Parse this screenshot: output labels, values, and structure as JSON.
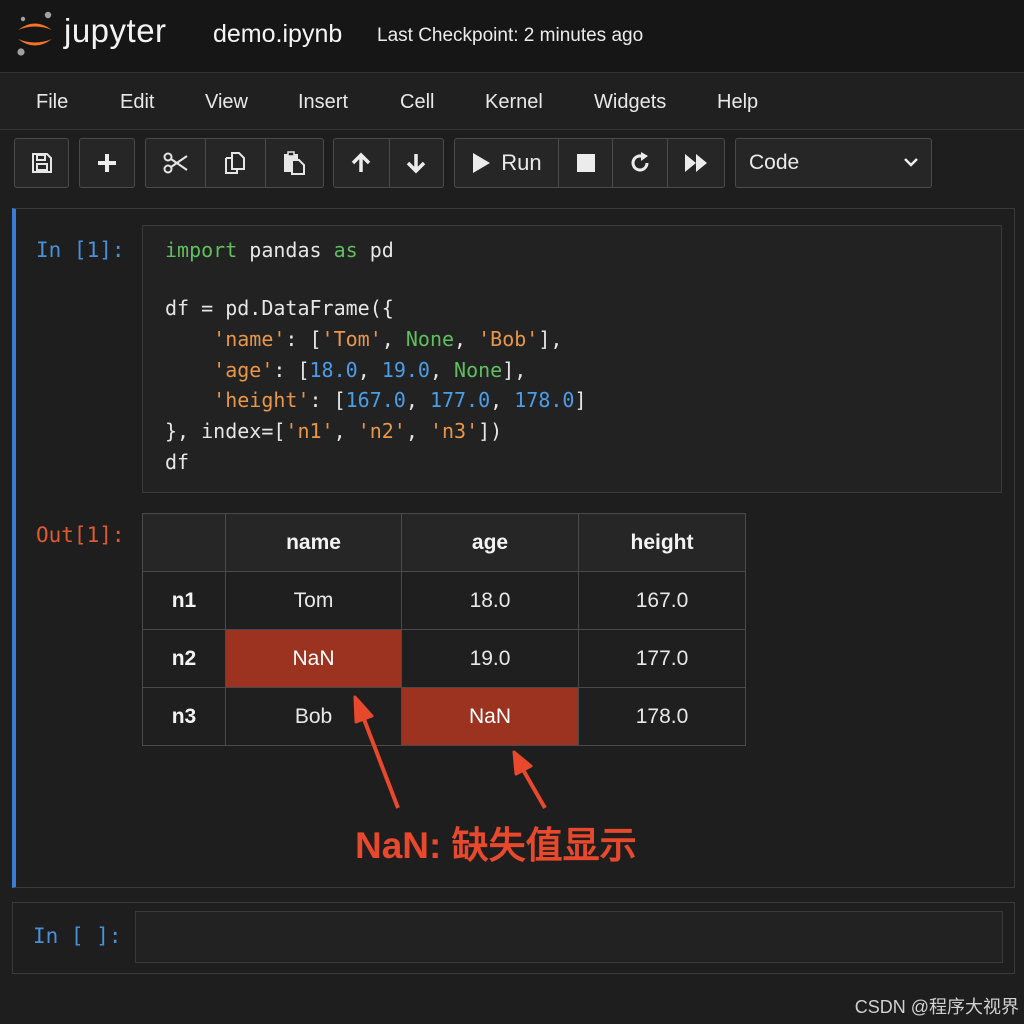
{
  "header": {
    "logo_text": "jupyter",
    "notebook_name": "demo.ipynb",
    "checkpoint": "Last Checkpoint: 2 minutes ago"
  },
  "menu": [
    "File",
    "Edit",
    "View",
    "Insert",
    "Cell",
    "Kernel",
    "Widgets",
    "Help"
  ],
  "toolbar": {
    "run_label": "Run",
    "cell_type": "Code"
  },
  "cell1": {
    "in_prompt": "In [1]:",
    "out_prompt": "Out[1]:",
    "code": {
      "l1": {
        "a": "import",
        "b": " pandas ",
        "c": "as",
        "d": " pd"
      },
      "l2": {
        "a": "df = pd.DataFrame({"
      },
      "l3": {
        "a": "    ",
        "b": "'name'",
        "c": ": [",
        "d": "'Tom'",
        "e": ", ",
        "f": "None",
        "g": ", ",
        "h": "'Bob'",
        "i": "],"
      },
      "l4": {
        "a": "    ",
        "b": "'age'",
        "c": ": [",
        "d": "18.0",
        "e": ", ",
        "f": "19.0",
        "g": ", ",
        "h": "None",
        "i": "],"
      },
      "l5": {
        "a": "    ",
        "b": "'height'",
        "c": ": [",
        "d": "167.0",
        "e": ", ",
        "f": "177.0",
        "g": ", ",
        "h": "178.0",
        "i": "]"
      },
      "l6": {
        "a": "}, index=[",
        "b": "'n1'",
        "c": ", ",
        "d": "'n2'",
        "e": ", ",
        "f": "'n3'",
        "g": "])"
      },
      "l7": {
        "a": "df"
      }
    },
    "output_table": {
      "columns": [
        "",
        "name",
        "age",
        "height"
      ],
      "rows": [
        {
          "index": "n1",
          "name": "Tom",
          "age": "18.0",
          "height": "167.0"
        },
        {
          "index": "n2",
          "name": "NaN",
          "age": "19.0",
          "height": "177.0"
        },
        {
          "index": "n3",
          "name": "Bob",
          "age": "NaN",
          "height": "178.0"
        }
      ],
      "highlight_color": "#9b3320"
    },
    "annotation": "NaN: 缺失值显示"
  },
  "cell2": {
    "in_prompt": "In [ ]:"
  },
  "watermark": "CSDN @程序大视界",
  "colors": {
    "accent_blue": "#3a7bd5",
    "out_prompt": "#e05a32",
    "annotation_red": "#e8482c"
  }
}
